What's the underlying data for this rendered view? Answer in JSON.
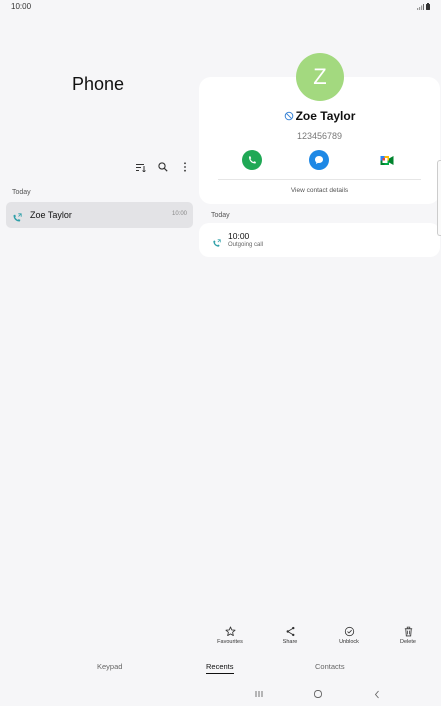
{
  "status_bar": {
    "time": "10:00"
  },
  "list_pane": {
    "title": "Phone",
    "section": "Today",
    "entries": [
      {
        "name": "Zoe Taylor",
        "time": "10:00"
      }
    ]
  },
  "contact": {
    "initial": "Z",
    "name": "Zoe Taylor",
    "number": "123456789",
    "view_details": "View contact details",
    "avatar_color": "#a3d97f"
  },
  "history": {
    "section": "Today",
    "entries": [
      {
        "time": "10:00",
        "type": "Outgoing call"
      }
    ]
  },
  "bottom_actions": {
    "favourites": "Favourites",
    "share": "Share",
    "unblock": "Unblock",
    "delete": "Delete"
  },
  "nav_tabs": {
    "keypad": "Keypad",
    "recents": "Recents",
    "contacts": "Contacts",
    "active": "Recents"
  },
  "colors": {
    "call": "#1fa855",
    "message": "#1e88e5",
    "outgoing_arrow": "#2e9fa8"
  }
}
